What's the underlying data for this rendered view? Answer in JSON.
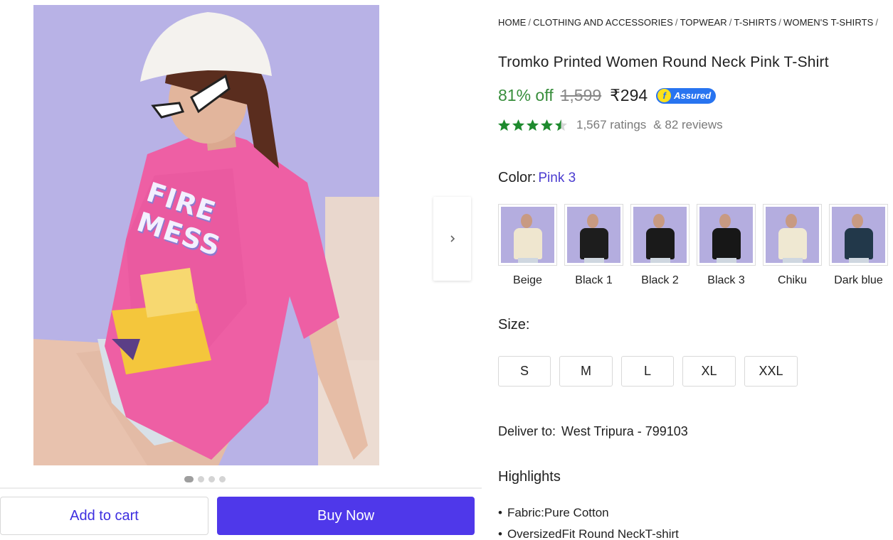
{
  "breadcrumbs": [
    "HOME",
    "CLOTHING AND ACCESSORIES",
    "TOPWEAR",
    "T-SHIRTS",
    "WOMEN'S T-SHIRTS"
  ],
  "breadcrumb_separator": "/",
  "product": {
    "image_icon": "product-photo",
    "title": "Tromko Printed Women Round Neck Pink T-Shirt",
    "discount": "81% off",
    "mrp": "1,599",
    "price": "₹294",
    "assured_label": "Assured",
    "rating_stars": 4.5,
    "ratings_text": "1,567 ratings",
    "reviews_text": "& 82 reviews"
  },
  "gallery": {
    "total_images": 4,
    "active_index": 0,
    "next_icon": "chevron-right-icon"
  },
  "color": {
    "label": "Color:",
    "selected": "Pink 3",
    "options": [
      {
        "name": "Beige",
        "shirt_color": "#efe6cf"
      },
      {
        "name": "Black 1",
        "shirt_color": "#1d1d1d"
      },
      {
        "name": "Black 2",
        "shirt_color": "#1a1a1a"
      },
      {
        "name": "Black 3",
        "shirt_color": "#171717"
      },
      {
        "name": "Chiku",
        "shirt_color": "#efe8d2"
      },
      {
        "name": "Dark blue",
        "shirt_color": "#22384a"
      }
    ]
  },
  "size": {
    "label": "Size:",
    "options": [
      "S",
      "M",
      "L",
      "XL",
      "XXL"
    ]
  },
  "delivery": {
    "label": "Deliver to:",
    "location": "West Tripura - 799103"
  },
  "highlights": {
    "title": "Highlights",
    "items": [
      "Fabric:Pure Cotton",
      "OversizedFit Round NeckT-shirt"
    ]
  },
  "actions": {
    "add_to_cart": "Add to cart",
    "buy_now": "Buy Now"
  },
  "colors": {
    "accent": "#4f38ea",
    "discount_green": "#388e3c",
    "star_green": "#1e8a2e",
    "assured_blue": "#2874f0"
  }
}
